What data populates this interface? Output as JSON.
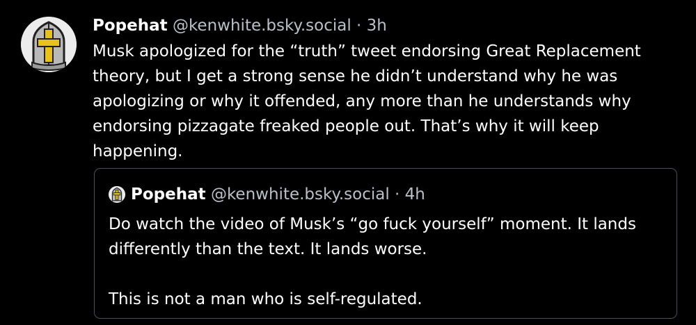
{
  "post": {
    "author_name": "Popehat",
    "handle": "@kenwhite.bsky.social",
    "separator": "·",
    "time": "3h",
    "text": "Musk apologized for the “truth” tweet endorsing Great Replacement theory, but I get a strong sense he didn’t understand why he was apologizing or why it offended, any more than he understands why endorsing pizzagate freaked people out.  That’s why it will keep happening."
  },
  "quoted_post": {
    "author_name": "Popehat",
    "handle": "@kenwhite.bsky.social",
    "separator": "·",
    "time": "4h",
    "paragraphs": [
      "Do watch the video of Musk’s “go fuck yourself” moment.  It lands differently than the text.  It lands worse.",
      "This is not a man who is self-regulated."
    ]
  },
  "icons": {
    "avatar": "popehat-mitre-icon"
  },
  "colors": {
    "background": "#000000",
    "text": "#ffffff",
    "muted": "#b8c0c8",
    "quote_border": "#4a5058",
    "mitre_gold": "#e8c11a"
  }
}
